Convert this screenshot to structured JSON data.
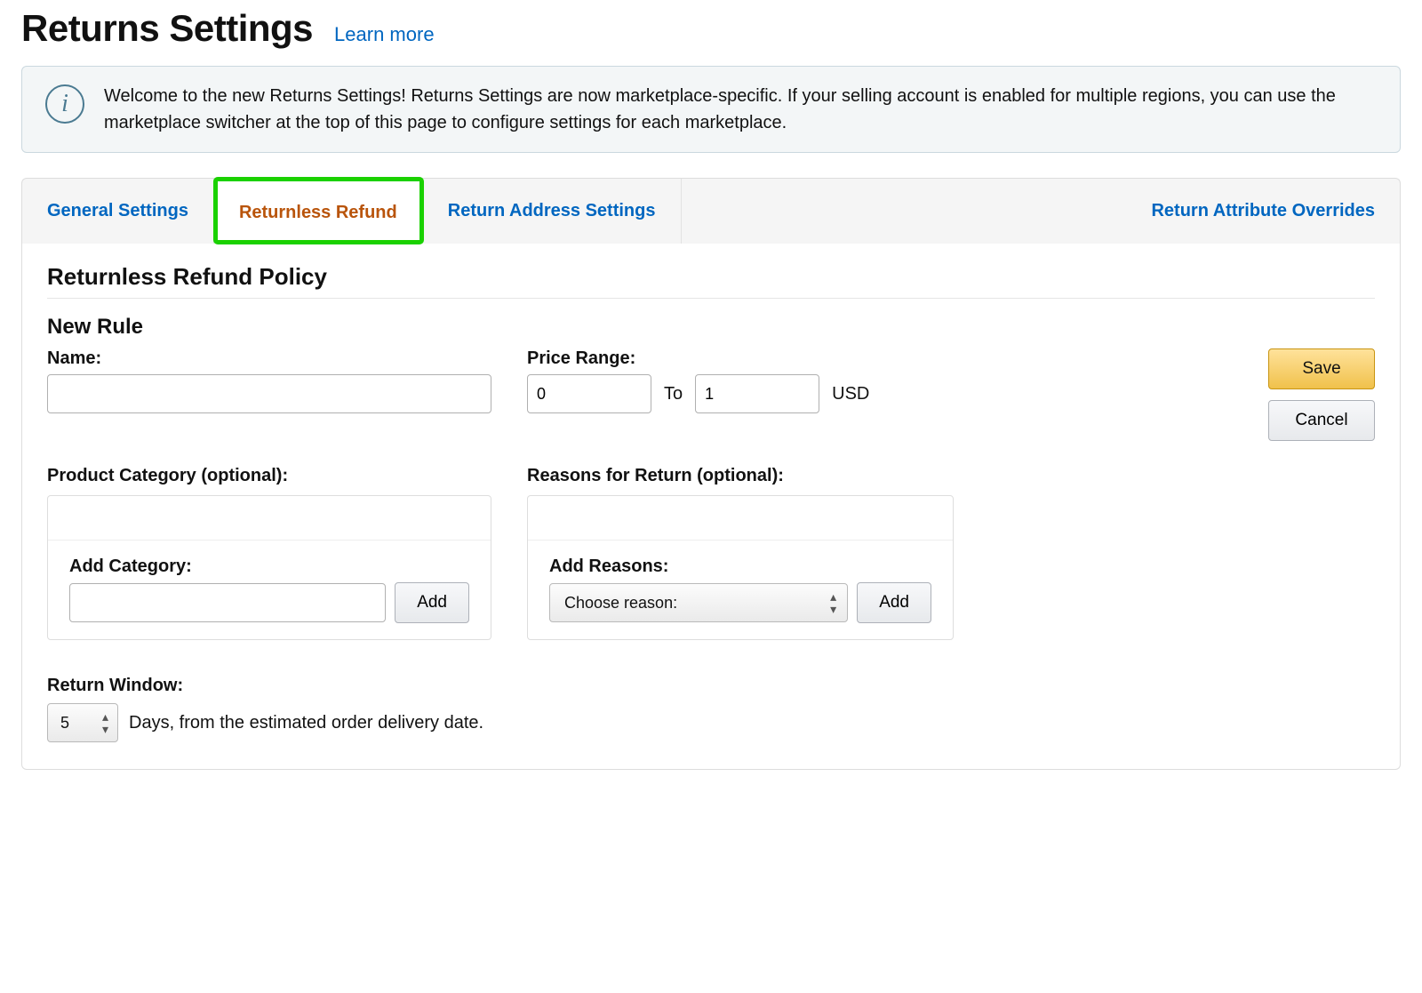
{
  "header": {
    "title": "Returns Settings",
    "learn_more": "Learn more"
  },
  "info": {
    "message": "Welcome to the new Returns Settings! Returns Settings are now marketplace-specific. If your selling account is enabled for multiple regions, you can use the marketplace switcher at the top of this page to configure settings for each marketplace."
  },
  "tabs": {
    "general": "General Settings",
    "returnless": "Returnless Refund",
    "address": "Return Address Settings",
    "overrides": "Return Attribute Overrides"
  },
  "sections": {
    "policy_heading": "Returnless Refund Policy",
    "new_rule_heading": "New Rule"
  },
  "form": {
    "name_label": "Name:",
    "name_value": "",
    "price_range_label": "Price Range:",
    "price_from": "0",
    "price_to_label": "To",
    "price_to": "1",
    "currency": "USD",
    "save_label": "Save",
    "cancel_label": "Cancel",
    "category_label": "Product Category (optional):",
    "add_category_label": "Add Category:",
    "add_category_value": "",
    "add_category_btn": "Add",
    "reasons_label": "Reasons for Return (optional):",
    "add_reasons_label": "Add Reasons:",
    "reason_select_placeholder": "Choose reason:",
    "add_reason_btn": "Add",
    "return_window_label": "Return Window:",
    "return_window_value": "5",
    "return_window_tail": "Days, from the estimated order delivery date."
  }
}
